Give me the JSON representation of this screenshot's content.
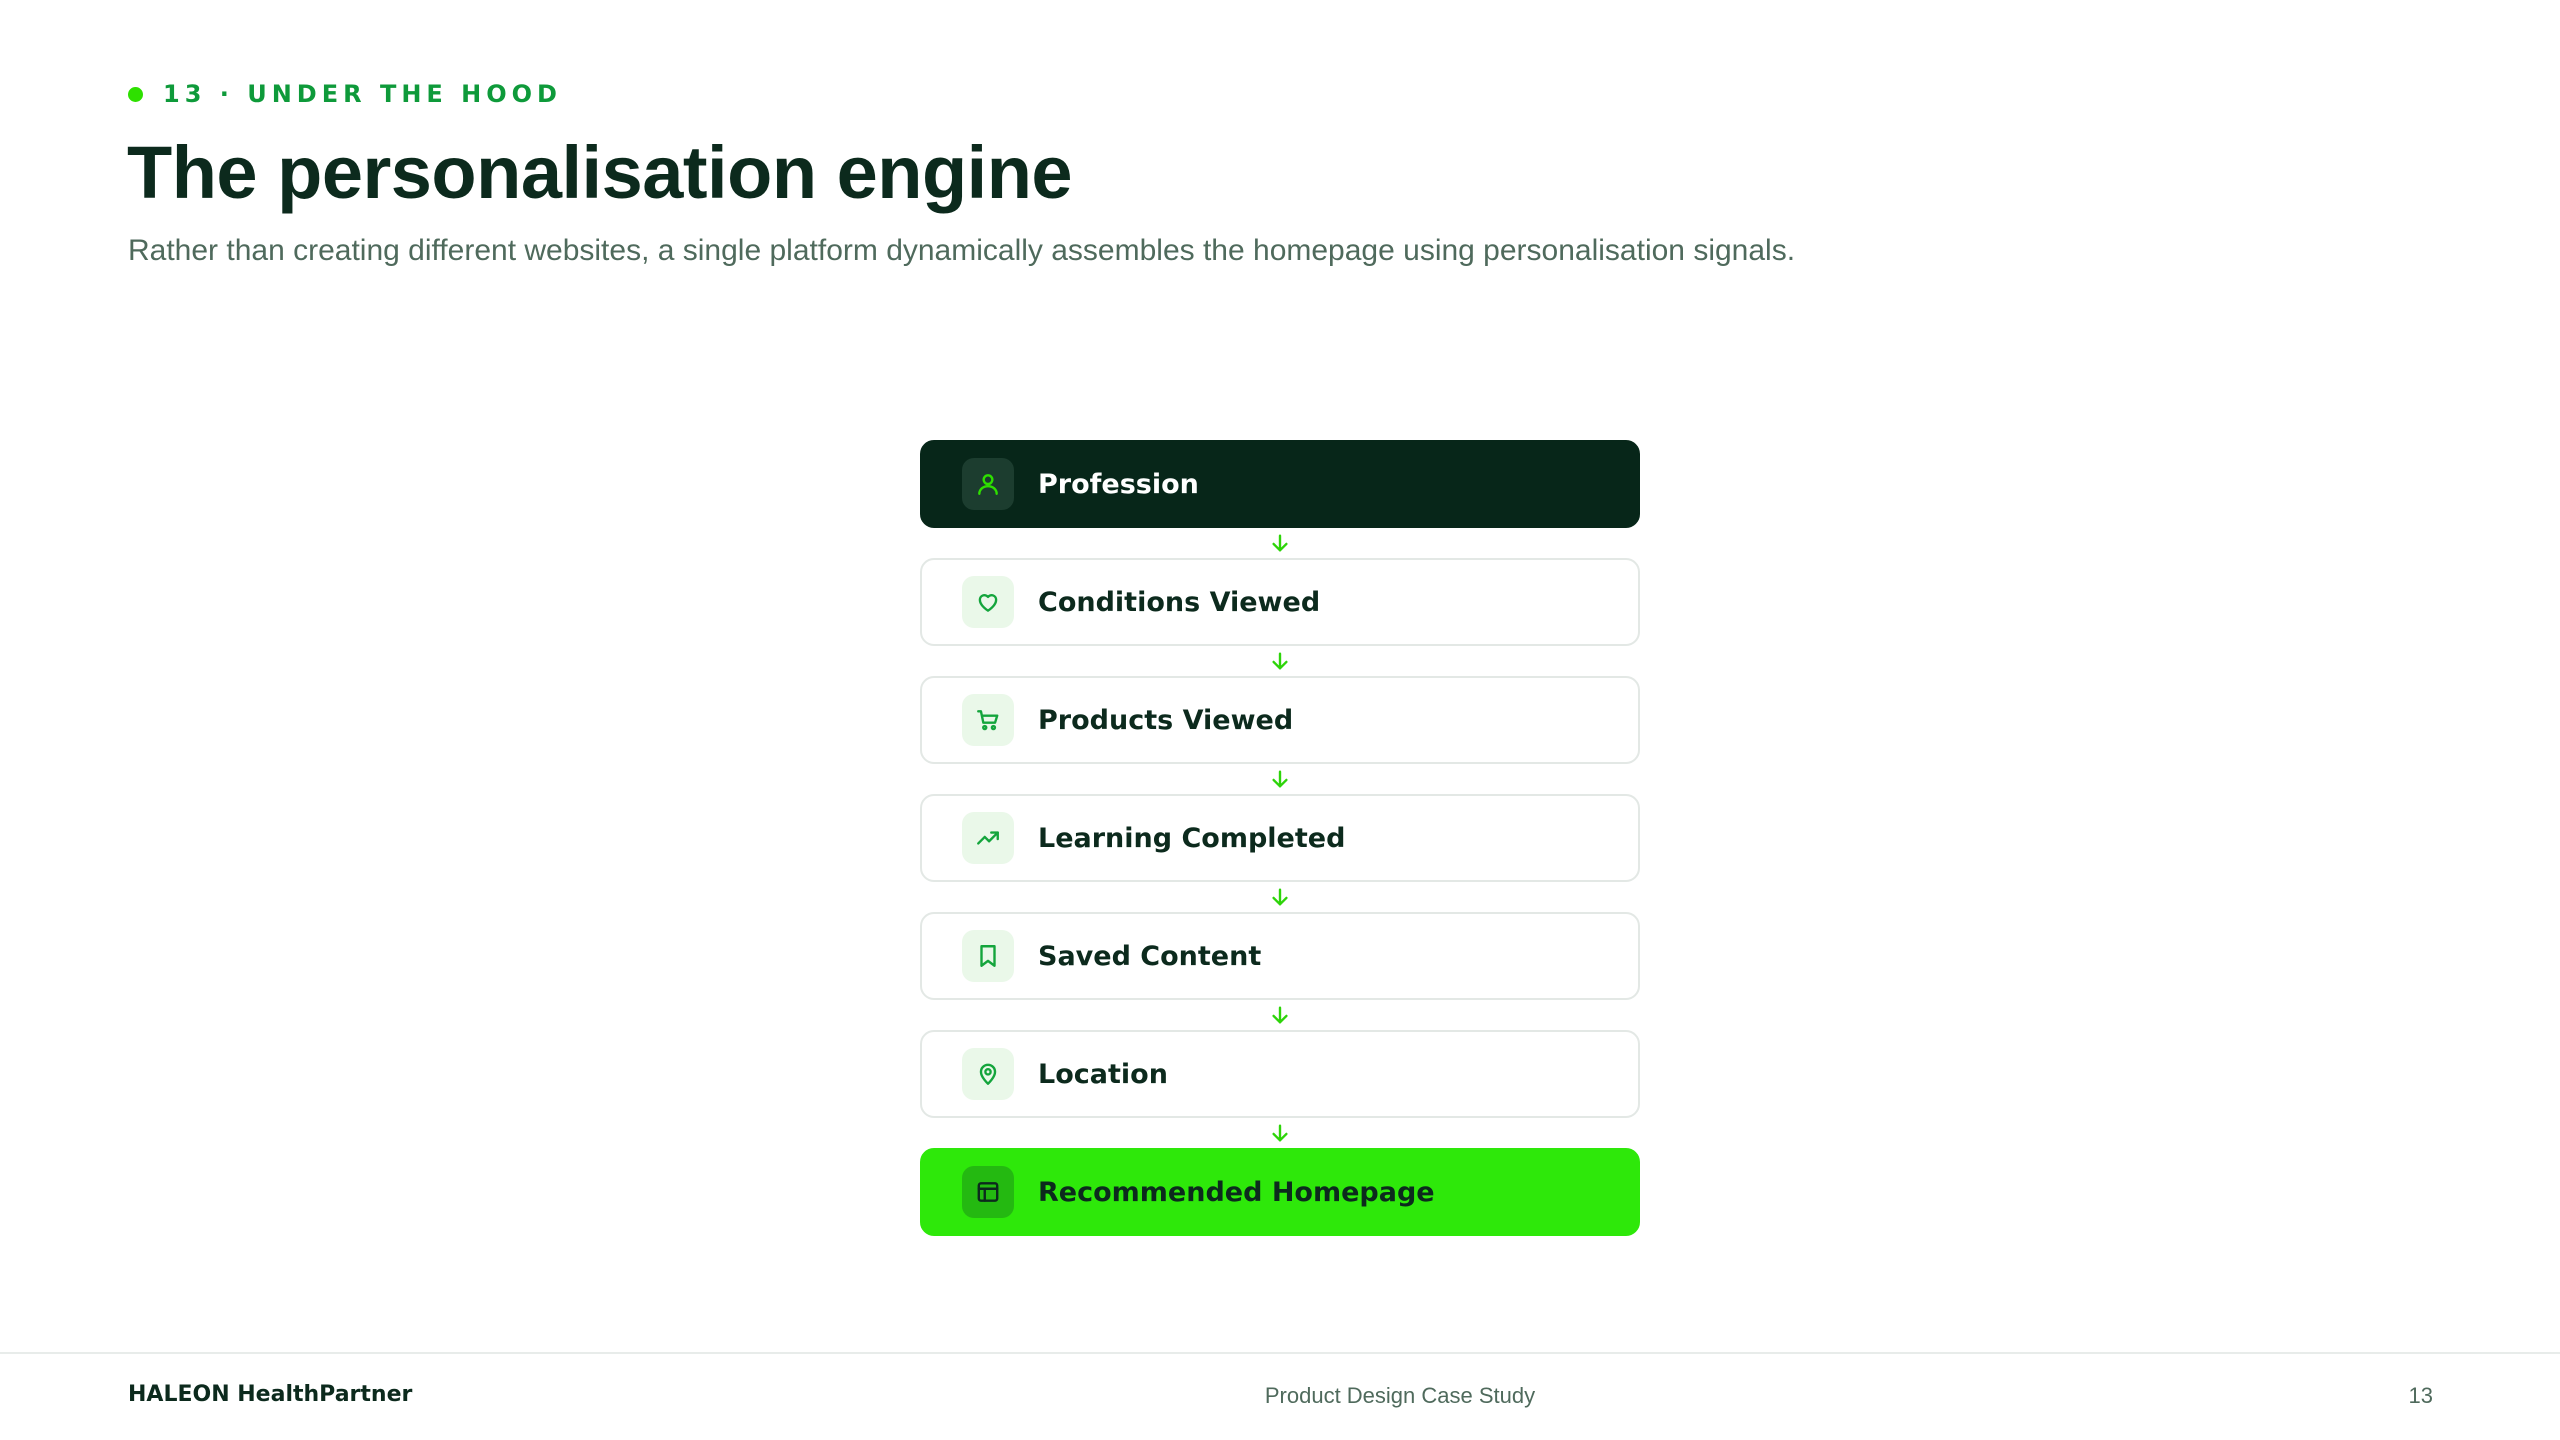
{
  "header": {
    "eyebrow": "13 · UNDER THE HOOD",
    "title": "The personalisation engine",
    "subtitle": "Rather than creating different websites, a single platform dynamically assembles the homepage using personalisation signals."
  },
  "flow": {
    "nodes": [
      {
        "label": "Profession",
        "icon": "user-icon",
        "style": "dark"
      },
      {
        "label": "Conditions Viewed",
        "icon": "heart-icon",
        "style": "default"
      },
      {
        "label": "Products Viewed",
        "icon": "cart-icon",
        "style": "default"
      },
      {
        "label": "Learning Completed",
        "icon": "trending-up-icon",
        "style": "default"
      },
      {
        "label": "Saved Content",
        "icon": "bookmark-icon",
        "style": "default"
      },
      {
        "label": "Location",
        "icon": "map-pin-icon",
        "style": "default"
      },
      {
        "label": "Recommended Homepage",
        "icon": "layout-icon",
        "style": "accent"
      }
    ]
  },
  "footer": {
    "brand": "HALEON HealthPartner",
    "center": "Product Design Case Study",
    "page": "13"
  },
  "colors": {
    "dark_node": "#072619",
    "accent": "#2ee80a",
    "eyebrow_text": "#0e9a3a",
    "arrow": "#2ed40a"
  }
}
